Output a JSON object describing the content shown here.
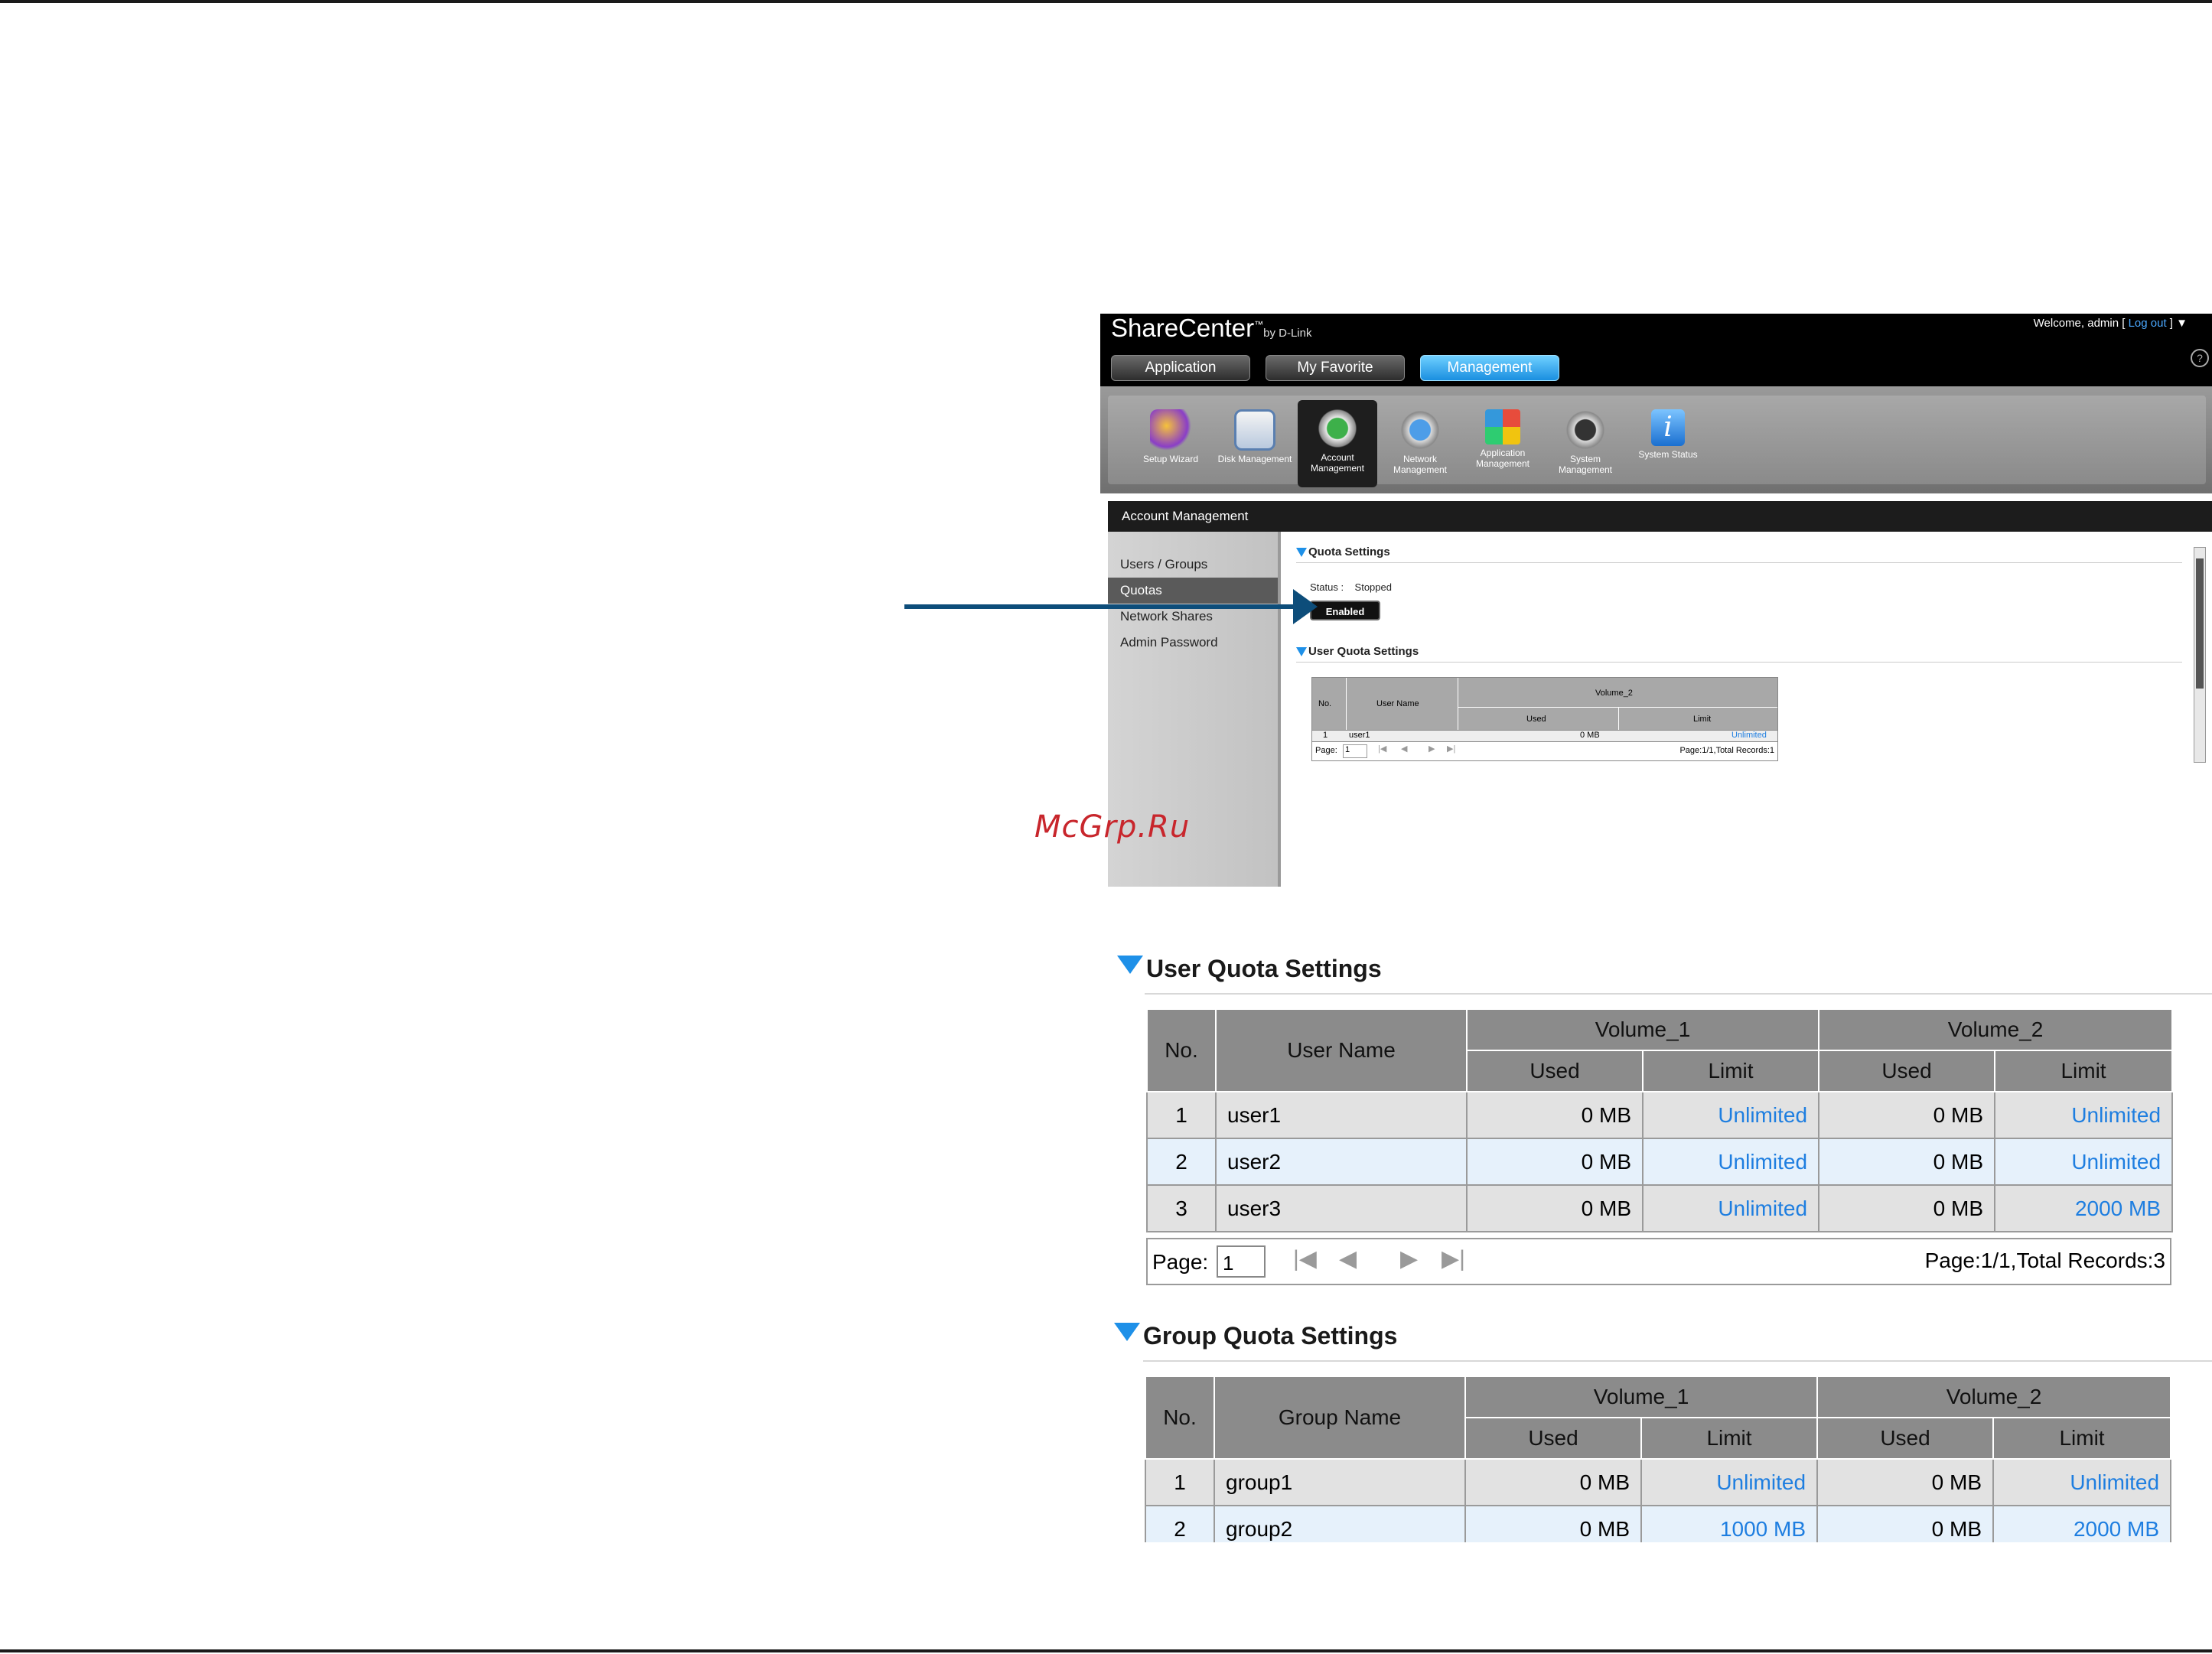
{
  "app": {
    "brand": "ShareCenter",
    "brand_sub": "by D-Link",
    "welcome_prefix": "Welcome, admin [ ",
    "logout": "Log out",
    "welcome_suffix": " ] ▼",
    "help": "?"
  },
  "tabs": [
    {
      "label": "Application"
    },
    {
      "label": "My Favorite"
    },
    {
      "label": "Management"
    }
  ],
  "tools": [
    {
      "label": "Setup Wizard",
      "icon": "wizard-icon"
    },
    {
      "label": "Disk Management",
      "icon": "disk-icon"
    },
    {
      "label": "Account Management",
      "icon": "account-icon"
    },
    {
      "label": "Network Management",
      "icon": "network-icon"
    },
    {
      "label": "Application Management",
      "icon": "apps-icon"
    },
    {
      "label": "System Management",
      "icon": "system-icon"
    },
    {
      "label": "System Status",
      "icon": "info-icon"
    }
  ],
  "section_title": "Account Management",
  "sidebar": [
    {
      "label": "Users / Groups"
    },
    {
      "label": "Quotas"
    },
    {
      "label": "Network Shares"
    },
    {
      "label": "Admin Password"
    }
  ],
  "quota_settings": {
    "title": "Quota Settings",
    "status_label": "Status :",
    "status_value": "Stopped",
    "button": "Enabled"
  },
  "mini_user_quota": {
    "title": "User Quota Settings",
    "col_no": "No.",
    "col_name": "User Name",
    "col_volume": "Volume_2",
    "col_used": "Used",
    "col_limit": "Limit",
    "row_no": "1",
    "row_name": "user1",
    "row_used": "0 MB",
    "row_limit": "Unlimited",
    "page_label": "Page:",
    "page_value": "1",
    "records": "Page:1/1,Total Records:1"
  },
  "watermark": "McGrp.Ru",
  "user_quota": {
    "title": "User Quota Settings",
    "col_no": "No.",
    "col_name": "User Name",
    "volume1": "Volume_1",
    "volume2": "Volume_2",
    "used": "Used",
    "limit": "Limit",
    "rows": [
      {
        "no": "1",
        "name": "user1",
        "v1_used": "0 MB",
        "v1_limit": "Unlimited",
        "v2_used": "0 MB",
        "v2_limit": "Unlimited"
      },
      {
        "no": "2",
        "name": "user2",
        "v1_used": "0 MB",
        "v1_limit": "Unlimited",
        "v2_used": "0 MB",
        "v2_limit": "Unlimited"
      },
      {
        "no": "3",
        "name": "user3",
        "v1_used": "0 MB",
        "v1_limit": "Unlimited",
        "v2_used": "0 MB",
        "v2_limit": "2000 MB"
      }
    ],
    "page_label": "Page:",
    "page_value": "1",
    "records": "Page:1/1,Total Records:3"
  },
  "group_quota": {
    "title": "Group Quota Settings",
    "col_no": "No.",
    "col_name": "Group Name",
    "volume1": "Volume_1",
    "volume2": "Volume_2",
    "used": "Used",
    "limit": "Limit",
    "rows": [
      {
        "no": "1",
        "name": "group1",
        "v1_used": "0 MB",
        "v1_limit": "Unlimited",
        "v2_used": "0 MB",
        "v2_limit": "Unlimited"
      },
      {
        "no": "2",
        "name": "group2",
        "v1_used": "0 MB",
        "v1_limit": "1000 MB",
        "v2_used": "0 MB",
        "v2_limit": "2000 MB"
      }
    ]
  }
}
